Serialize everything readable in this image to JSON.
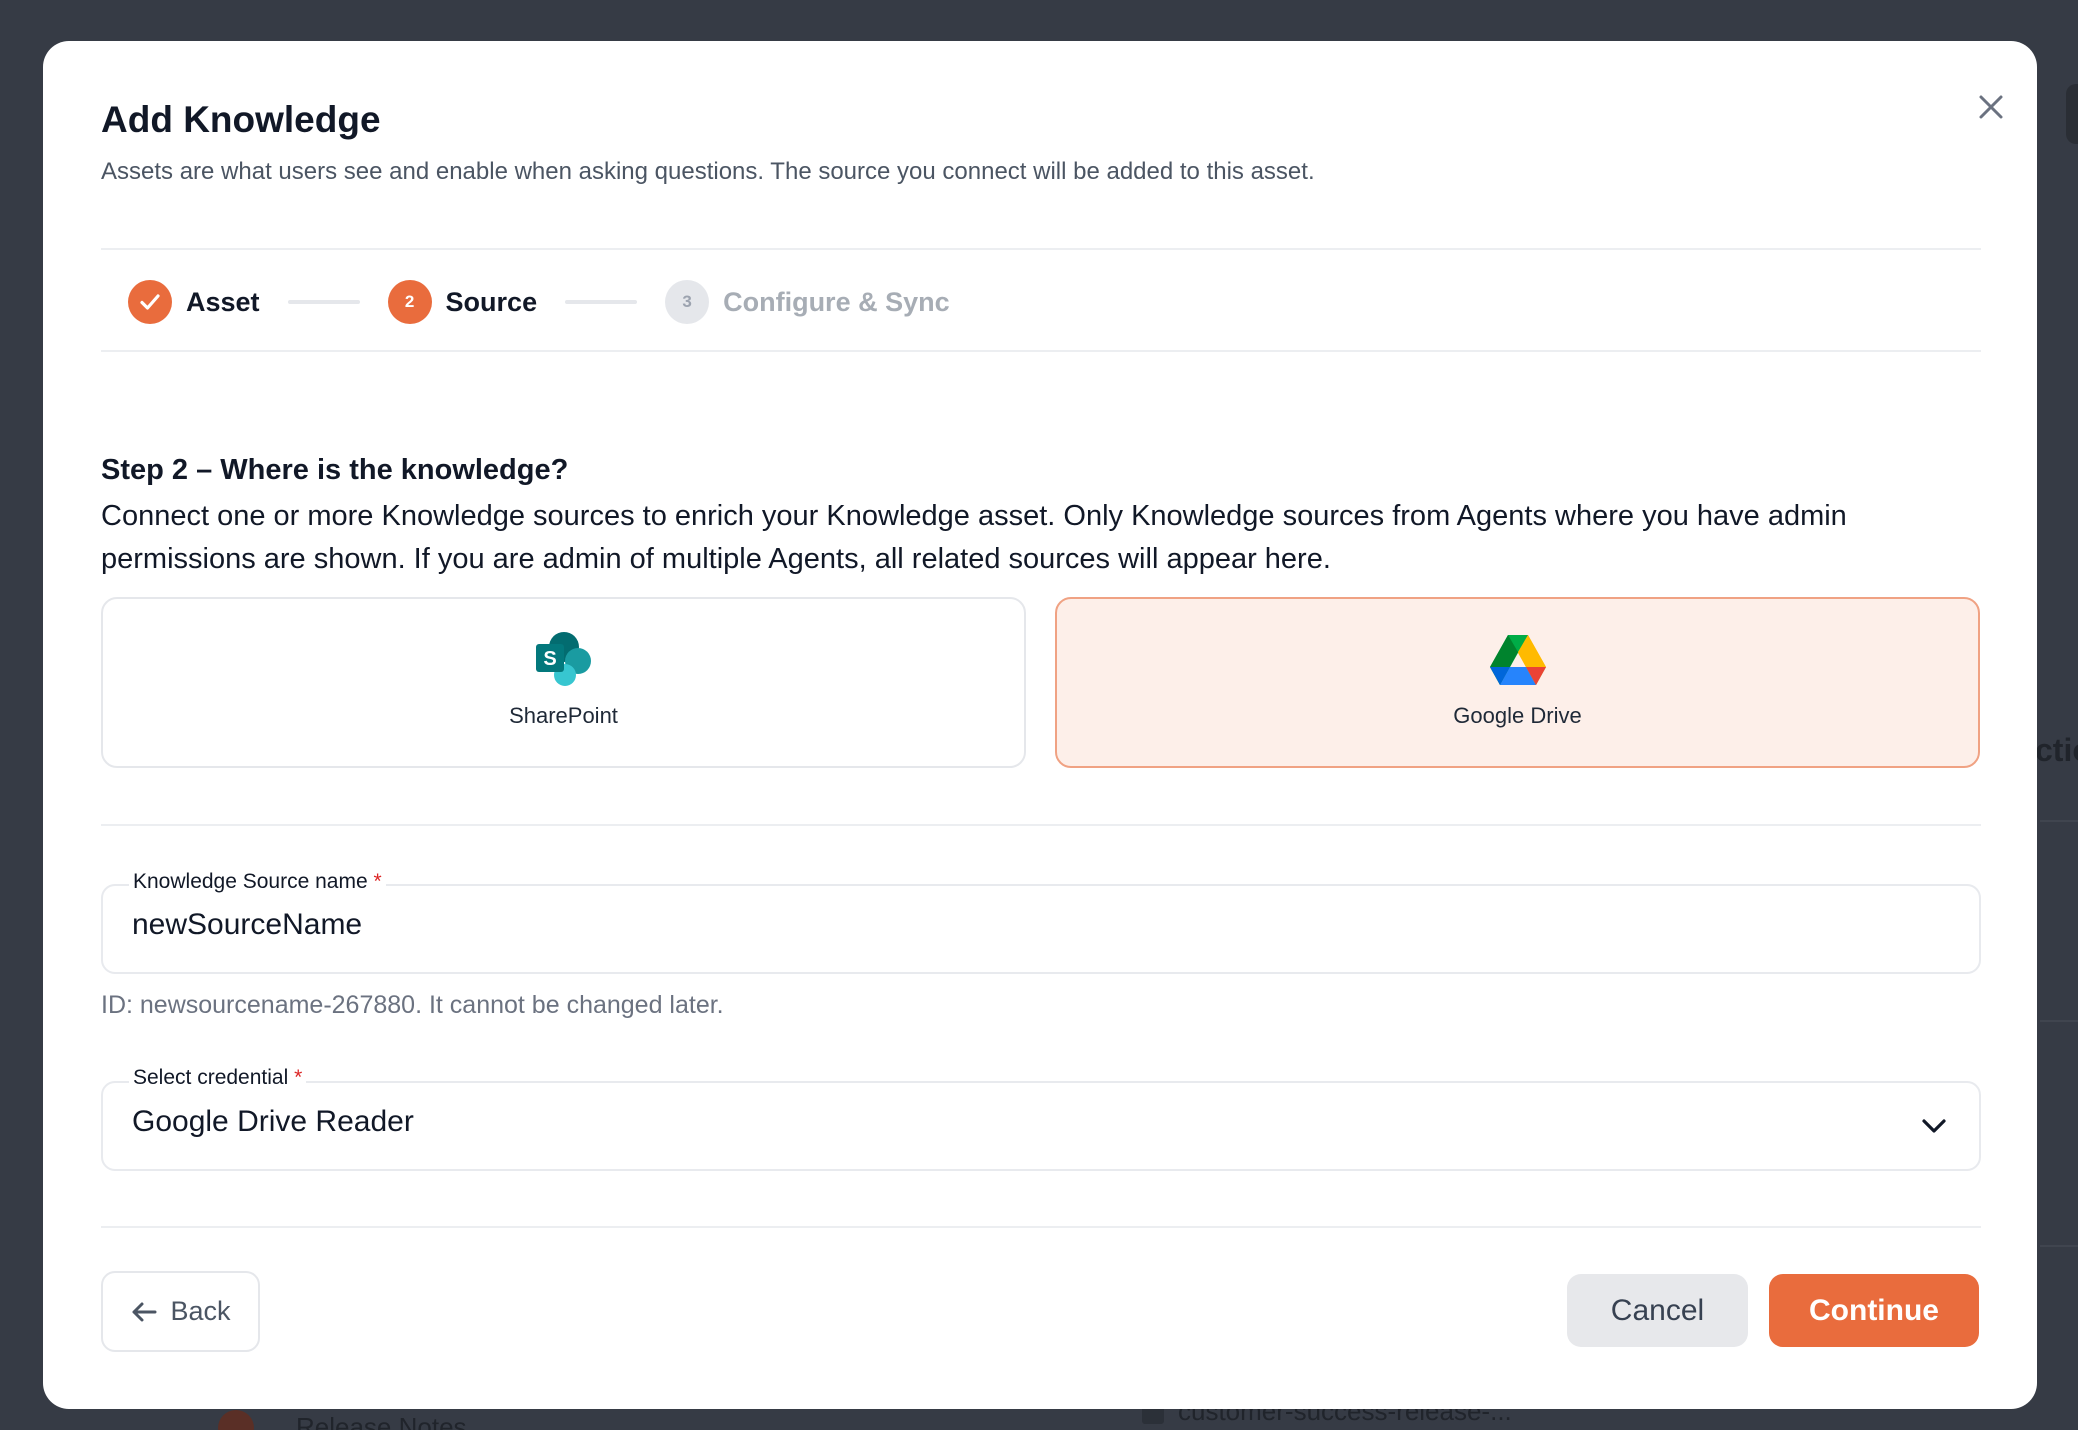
{
  "modal": {
    "title": "Add Knowledge",
    "subtitle": "Assets are what users see and enable when asking questions. The source you connect will be added to this asset.",
    "close_icon": "close-icon"
  },
  "stepper": {
    "steps": [
      {
        "number": "1",
        "label": "Asset",
        "state": "done"
      },
      {
        "number": "2",
        "label": "Source",
        "state": "active"
      },
      {
        "number": "3",
        "label": "Configure & Sync",
        "state": "pending"
      }
    ]
  },
  "section": {
    "title": "Step 2 – Where is the knowledge?",
    "description": "Connect one or more Knowledge sources to enrich your Knowledge asset. Only Knowledge sources from Agents where you have admin permissions are shown. If you are admin of multiple Agents, all related sources will appear here."
  },
  "sources": [
    {
      "label": "SharePoint",
      "icon": "sharepoint-icon",
      "selected": false
    },
    {
      "label": "Google Drive",
      "icon": "google-drive-icon",
      "selected": true
    }
  ],
  "form": {
    "source_name_label": "Knowledge Source name",
    "source_name_value": "newSourceName",
    "required_mark": "*",
    "id_helper": "ID: newsourcename-267880. It cannot be changed later.",
    "credential_label": "Select credential",
    "credential_value": "Google Drive Reader"
  },
  "footer": {
    "back_label": "Back",
    "cancel_label": "Cancel",
    "continue_label": "Continue"
  },
  "background": {
    "fragment_right": "ctio",
    "fragment_bottom_left": "Release Notes",
    "fragment_bottom_mid": "customer-success-release-..."
  },
  "colors": {
    "accent": "#e96c3d",
    "selected_card_bg": "#fdefe9",
    "selected_card_border": "#f0a283",
    "overlay": "#363b45"
  }
}
